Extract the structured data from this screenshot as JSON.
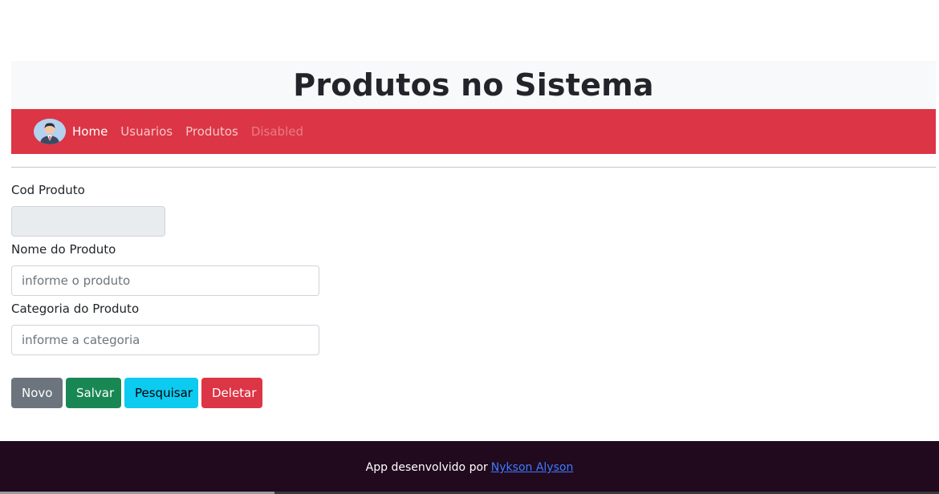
{
  "header": {
    "title": "Produtos no Sistema"
  },
  "navbar": {
    "items": [
      {
        "label": "Home",
        "state": "active"
      },
      {
        "label": "Usuarios",
        "state": "normal"
      },
      {
        "label": "Produtos",
        "state": "normal"
      },
      {
        "label": "Disabled",
        "state": "disabled"
      }
    ],
    "avatar_icon": "user-avatar-icon",
    "color": "#dc3545"
  },
  "form": {
    "cod": {
      "label": "Cod Produto",
      "value": "",
      "placeholder": ""
    },
    "nome": {
      "label": "Nome do Produto",
      "value": "",
      "placeholder": "informe o produto"
    },
    "categoria": {
      "label": "Categoria do Produto",
      "value": "",
      "placeholder": "informe a categoria"
    }
  },
  "buttons": {
    "novo": "Novo",
    "salvar": "Salvar",
    "pesquisar": "Pesquisar",
    "deletar": "Deletar"
  },
  "footer": {
    "text": "App desenvolvido por",
    "link": "Nykson Alyson"
  }
}
